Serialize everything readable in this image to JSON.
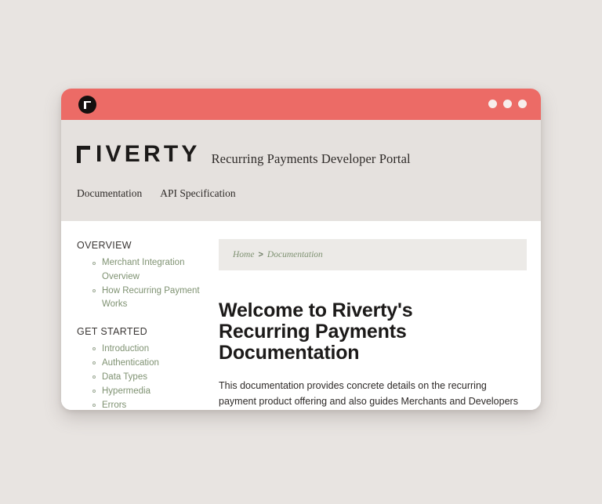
{
  "window": {
    "favicon_icon": "riverty-r-mark-icon",
    "dots": [
      "window-dot-1",
      "window-dot-2",
      "window-dot-3"
    ],
    "title_bar_color": "#ec6b66"
  },
  "header": {
    "logo_r_glyph": "riverty-corner-r-icon",
    "logo_text": "IVERTY",
    "portal_title": "Recurring Payments Developer Portal",
    "background_color": "#e5e1de",
    "nav": [
      {
        "label": "Documentation"
      },
      {
        "label": "API Specification"
      }
    ]
  },
  "sidebar": {
    "sections": [
      {
        "heading": "OVERVIEW",
        "items": [
          {
            "label": "Merchant Integration Overview"
          },
          {
            "label": "How Recurring Payment Works"
          }
        ]
      },
      {
        "heading": "GET STARTED",
        "items": [
          {
            "label": "Introduction"
          },
          {
            "label": "Authentication"
          },
          {
            "label": "Data Types"
          },
          {
            "label": "Hypermedia"
          },
          {
            "label": "Errors"
          }
        ]
      }
    ],
    "link_color": "#7f9272"
  },
  "main": {
    "breadcrumb": {
      "home": "Home",
      "separator": ">",
      "current": "Documentation"
    },
    "title": "Welcome to Riverty's Recurring Payments Documentation",
    "intro": "This documentation provides concrete details on the recurring payment product offering and also guides Merchants and Developers on how to integrate with the Recurring Payment APIs."
  },
  "page": {
    "background_color": "#e8e4e1"
  }
}
